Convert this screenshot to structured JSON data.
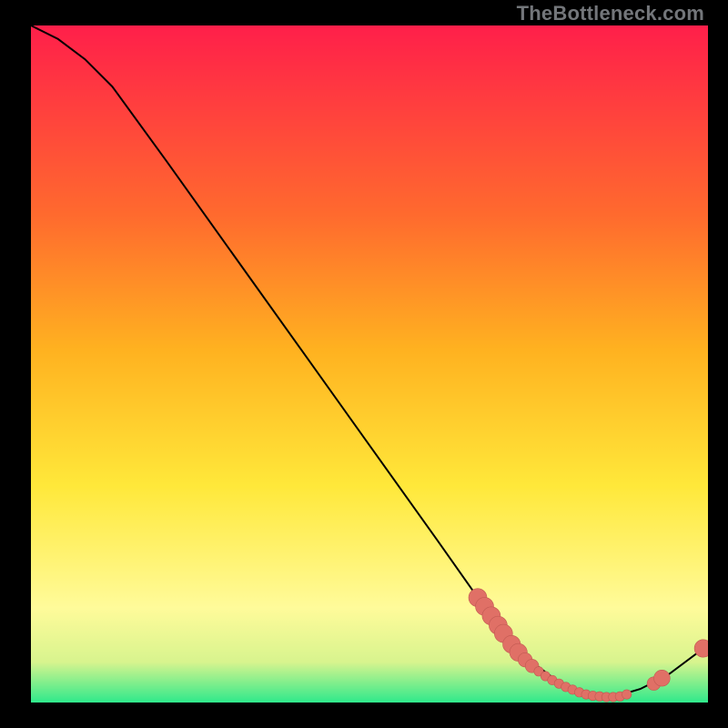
{
  "watermark": "TheBottleneck.com",
  "colors": {
    "gradient_top": "#ff1f4a",
    "gradient_mid1": "#ff6a2e",
    "gradient_mid2": "#ffb220",
    "gradient_mid3": "#ffe83a",
    "gradient_mid4": "#fffb9a",
    "gradient_mid5": "#d8f48e",
    "gradient_bot": "#2fe98b",
    "curve": "#000000",
    "marker_fill": "#e07066",
    "marker_stroke": "#c25a52",
    "frame": "#000000"
  },
  "chart_data": {
    "type": "line",
    "title": "",
    "xlabel": "",
    "ylabel": "",
    "xlim": [
      0,
      100
    ],
    "ylim": [
      0,
      100
    ],
    "curve": [
      {
        "x": 0,
        "y": 100
      },
      {
        "x": 4,
        "y": 98
      },
      {
        "x": 8,
        "y": 95
      },
      {
        "x": 12,
        "y": 91
      },
      {
        "x": 20,
        "y": 80
      },
      {
        "x": 30,
        "y": 66
      },
      {
        "x": 40,
        "y": 52
      },
      {
        "x": 50,
        "y": 38
      },
      {
        "x": 60,
        "y": 24
      },
      {
        "x": 66,
        "y": 15.5
      },
      {
        "x": 70,
        "y": 10
      },
      {
        "x": 74,
        "y": 6
      },
      {
        "x": 78,
        "y": 3
      },
      {
        "x": 82,
        "y": 1.2
      },
      {
        "x": 86,
        "y": 0.8
      },
      {
        "x": 90,
        "y": 2
      },
      {
        "x": 94,
        "y": 4
      },
      {
        "x": 98,
        "y": 7
      },
      {
        "x": 100,
        "y": 8.5
      }
    ],
    "markers": [
      {
        "x": 66.0,
        "y": 15.5,
        "r": 2.7
      },
      {
        "x": 67.0,
        "y": 14.2,
        "r": 2.7
      },
      {
        "x": 68.0,
        "y": 12.8,
        "r": 2.7
      },
      {
        "x": 69.0,
        "y": 11.4,
        "r": 2.7
      },
      {
        "x": 69.8,
        "y": 10.2,
        "r": 2.7
      },
      {
        "x": 71.0,
        "y": 8.6,
        "r": 2.6
      },
      {
        "x": 72.0,
        "y": 7.4,
        "r": 2.6
      },
      {
        "x": 73.0,
        "y": 6.3,
        "r": 2.1
      },
      {
        "x": 74.0,
        "y": 5.4,
        "r": 2.0
      },
      {
        "x": 75.0,
        "y": 4.6,
        "r": 1.4
      },
      {
        "x": 76.0,
        "y": 3.9,
        "r": 1.4
      },
      {
        "x": 77.0,
        "y": 3.3,
        "r": 1.4
      },
      {
        "x": 78.0,
        "y": 2.8,
        "r": 1.4
      },
      {
        "x": 79.0,
        "y": 2.3,
        "r": 1.4
      },
      {
        "x": 80.0,
        "y": 1.9,
        "r": 1.4
      },
      {
        "x": 81.0,
        "y": 1.5,
        "r": 1.4
      },
      {
        "x": 82.0,
        "y": 1.2,
        "r": 1.4
      },
      {
        "x": 83.0,
        "y": 1.0,
        "r": 1.4
      },
      {
        "x": 84.0,
        "y": 0.9,
        "r": 1.4
      },
      {
        "x": 85.0,
        "y": 0.8,
        "r": 1.4
      },
      {
        "x": 86.0,
        "y": 0.8,
        "r": 1.4
      },
      {
        "x": 87.0,
        "y": 0.9,
        "r": 1.4
      },
      {
        "x": 88.0,
        "y": 1.2,
        "r": 1.4
      },
      {
        "x": 92.0,
        "y": 2.8,
        "r": 2.0
      },
      {
        "x": 93.2,
        "y": 3.6,
        "r": 2.4
      },
      {
        "x": 99.3,
        "y": 8.0,
        "r": 2.6
      }
    ]
  }
}
